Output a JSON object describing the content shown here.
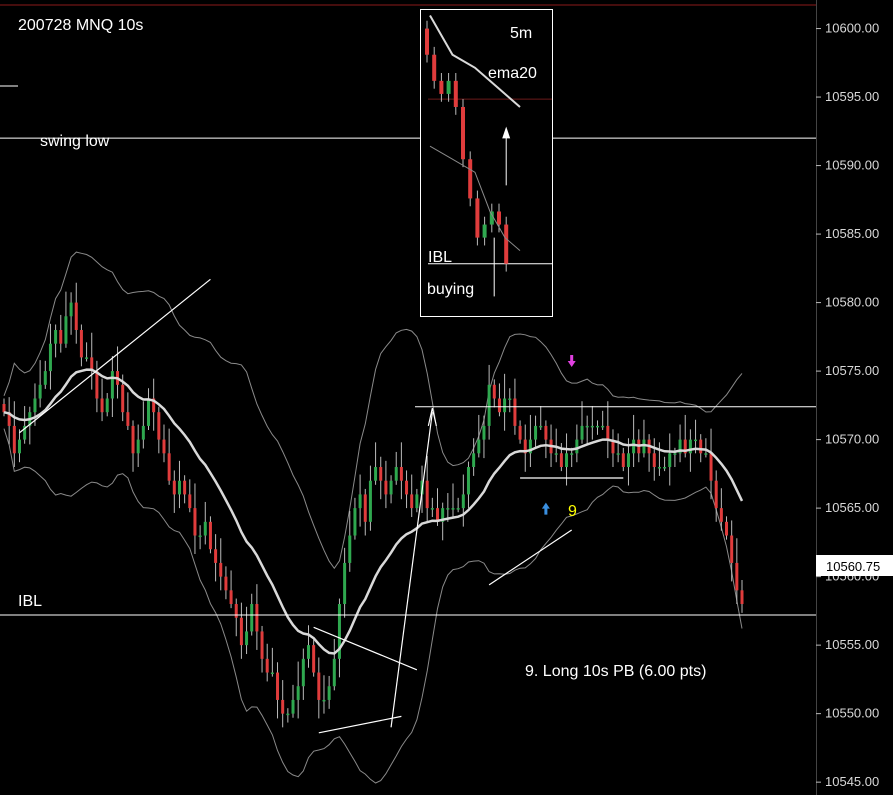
{
  "chart_data": {
    "type": "candlestick",
    "title": "200728 MNQ 10s",
    "ylim": [
      10544.5,
      10601.5
    ],
    "y_ticks": [
      10545,
      10550,
      10555,
      10560,
      10565,
      10570,
      10575,
      10580,
      10585,
      10590,
      10595,
      10600
    ],
    "tick_labels": [
      "10545.00",
      "10550.00",
      "10555.00",
      "10560.00",
      "10565.00",
      "10570.00",
      "10575.00",
      "10580.00",
      "10585.00",
      "10590.00",
      "10595.00",
      "10600.00"
    ],
    "last_price": "10560.75",
    "colors": {
      "up": "#2fa84f",
      "down": "#e03c3c",
      "ema": "#d9d9d9",
      "band": "#8a8a8a",
      "buy_arrow": "#3a8fe0",
      "sell_arrow": "#e040e0",
      "signal": "#ffff00"
    },
    "levels": [
      {
        "name": "swing low",
        "label": "swing low",
        "price": 10592
      },
      {
        "name": "IBL",
        "label": "IBL",
        "price": 10557.2
      },
      {
        "name": "range top",
        "label": "",
        "price": 10572.4
      }
    ],
    "annotations": {
      "trade_label": "9. Long 10s PB (6.00 pts)",
      "signal_number": "9"
    },
    "inset": {
      "title": "5m",
      "ema_label": "ema20",
      "ibl_label": "IBL",
      "note": "buying",
      "ylim": [
        10578,
        10601.5
      ]
    },
    "series": {
      "close": [
        10572,
        10571,
        10569,
        10570,
        10571,
        10572,
        10573,
        10574,
        10575,
        10577,
        10578,
        10577,
        10579,
        10580,
        10578,
        10576,
        10576,
        10575,
        10573,
        10572,
        10573,
        10575,
        10574,
        10572,
        10571,
        10569,
        10570,
        10571,
        10573,
        10572,
        10570,
        10569,
        10567,
        10566,
        10567,
        10566,
        10565,
        10563,
        10563,
        10564,
        10562,
        10561,
        10560,
        10559,
        10558,
        10557,
        10555,
        10556,
        10558,
        10556,
        10554,
        10553,
        10553,
        10551,
        10550,
        10550,
        10551,
        10552,
        10554,
        10555,
        10553,
        10551,
        10551,
        10552,
        10554,
        10558,
        10561,
        10563,
        10565,
        10566,
        10564,
        10567,
        10568,
        10567,
        10566,
        10567,
        10568,
        10567,
        10566,
        10565,
        10566,
        10567,
        10565,
        10565,
        10564,
        10565,
        10565,
        10565,
        10565,
        10566,
        10568,
        10569,
        10570,
        10571,
        10574,
        10573,
        10572,
        10573,
        10573,
        10571,
        10570,
        10569,
        10570,
        10571,
        10571,
        10570,
        10569,
        10569,
        10568,
        10569,
        10569,
        10570,
        10571,
        10571,
        10571,
        10571,
        10571,
        10570,
        10569,
        10569,
        10568,
        10569,
        10570,
        10569,
        10570,
        10569,
        10568,
        10568,
        10568,
        10569,
        10569,
        10570,
        10569,
        10570,
        10570,
        10569,
        10569,
        10567,
        10565,
        10564,
        10563,
        10561,
        10559,
        10558
      ]
    }
  }
}
